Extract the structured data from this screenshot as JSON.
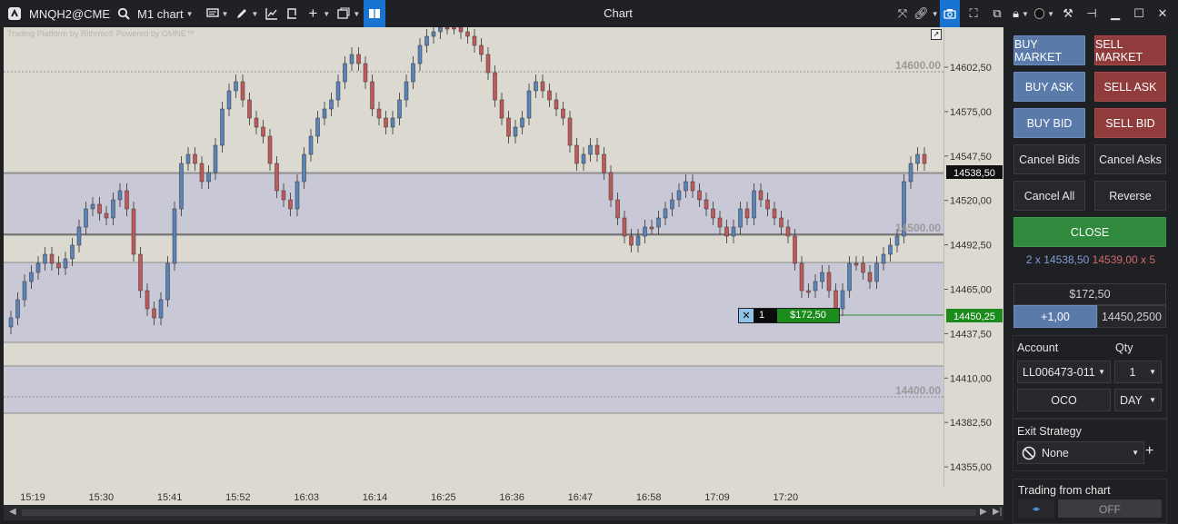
{
  "toolbar": {
    "symbol": "MNQH2@CME",
    "chart_type": "M1 chart",
    "title": "Chart"
  },
  "chart": {
    "watermark": "Trading Platform by Rithmic®  Powered by OMNE™",
    "level_labels": [
      "14600.00",
      "14500.00",
      "14400.00"
    ],
    "price_ticks": [
      "14602,50",
      "14575,00",
      "14547,50",
      "14520,00",
      "14492,50",
      "14465,00",
      "14437,50",
      "14410,00",
      "14382,50",
      "14355,00"
    ],
    "time_ticks": [
      "15:19",
      "15:30",
      "15:41",
      "15:52",
      "16:03",
      "16:14",
      "16:25",
      "16:36",
      "16:47",
      "16:58",
      "17:09",
      "17:20"
    ],
    "current_price": "14538,50",
    "position_price": "14450,25",
    "order_qty": "1",
    "order_pnl": "$172,50",
    "colors": {
      "up": "#5b83b8",
      "down": "#c05a5a",
      "zone": "#c9c8d6",
      "bg": "#dcdad0"
    }
  },
  "panel": {
    "buy_market": "BUY MARKET",
    "sell_market": "SELL MARKET",
    "buy_ask": "BUY ASK",
    "sell_ask": "SELL ASK",
    "buy_bid": "BUY BID",
    "sell_bid": "SELL BID",
    "cancel_bids": "Cancel Bids",
    "cancel_asks": "Cancel Asks",
    "cancel_all": "Cancel All",
    "reverse": "Reverse",
    "close": "CLOSE",
    "bid_summary": "2 x 14538,50",
    "ask_summary": "14539,00 x 5",
    "pnl": "$172,50",
    "position_qty": "+1,00",
    "avg_price": "14450,2500",
    "account_label": "Account",
    "qty_label": "Qty",
    "account_value": "LL006473-011",
    "qty_value": "1",
    "oco": "OCO",
    "tif": "DAY",
    "exit_strategy_label": "Exit Strategy",
    "exit_strategy_value": "None",
    "trading_from_chart_label": "Trading from chart",
    "trading_toggle": "OFF"
  }
}
